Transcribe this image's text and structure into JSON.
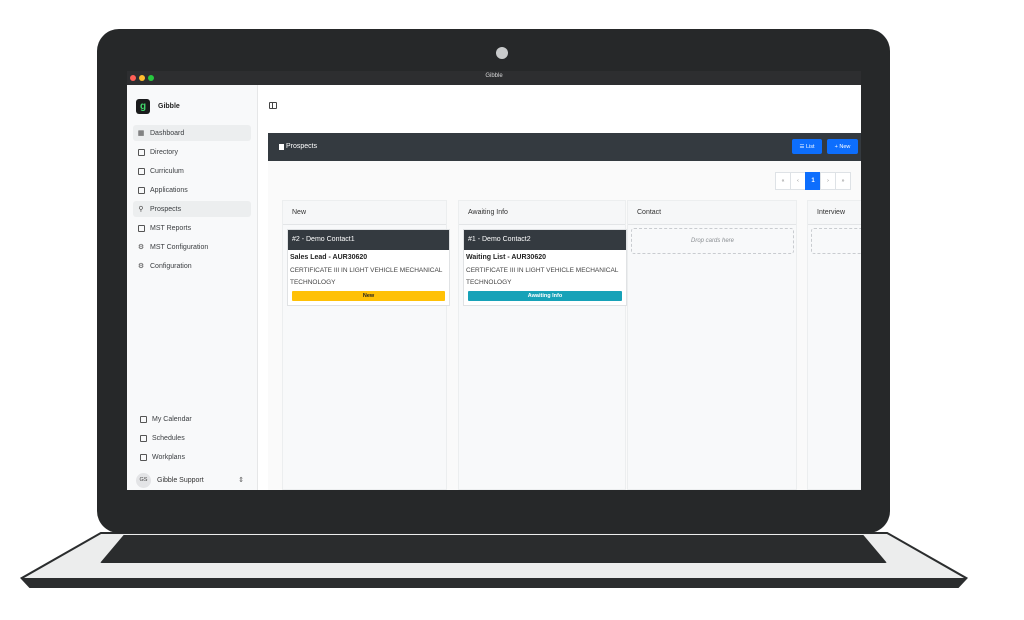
{
  "window": {
    "title": "Gibble"
  },
  "brand": {
    "logo": "g",
    "name": "Gibble"
  },
  "sidebar": {
    "items": [
      {
        "label": "Dashboard",
        "icon": "grid-icon"
      },
      {
        "label": "Directory",
        "icon": "book-icon"
      },
      {
        "label": "Curriculum",
        "icon": "monitor-icon"
      },
      {
        "label": "Applications",
        "icon": "file-icon"
      },
      {
        "label": "Prospects",
        "icon": "user-icon"
      },
      {
        "label": "MST Reports",
        "icon": "calendar-icon"
      },
      {
        "label": "MST Configuration",
        "icon": "gear-icon"
      },
      {
        "label": "Configuration",
        "icon": "gear-icon"
      }
    ],
    "bottom_items": [
      {
        "label": "My Calendar",
        "icon": "calendar-icon"
      },
      {
        "label": "Schedules",
        "icon": "calendar-icon"
      },
      {
        "label": "Workplans",
        "icon": "clipboard-icon"
      }
    ],
    "user": {
      "initials": "GS",
      "name": "Gibble Support"
    }
  },
  "main": {
    "header_title": "Prospects",
    "list_button": "☰ List",
    "new_button": "+ New",
    "pagination": {
      "first": "«",
      "prev": "‹",
      "current": "1",
      "next": "›",
      "last": "»"
    },
    "columns": [
      {
        "title": "New",
        "card": {
          "title": "#2 - Demo Contact1",
          "subtitle": "Sales Lead - AUR30620",
          "course": "CERTIFICATE III IN LIGHT VEHICLE MECHANICAL TECHNOLOGY",
          "badge": "New"
        }
      },
      {
        "title": "Awaiting Info",
        "card": {
          "title": "#1 - Demo Contact2",
          "subtitle": "Waiting List - AUR30620",
          "course": "CERTIFICATE III IN LIGHT VEHICLE MECHANICAL TECHNOLOGY",
          "badge": "Awaiting Info"
        }
      },
      {
        "title": "Contact",
        "placeholder": "Drop cards here"
      },
      {
        "title": "Interview"
      }
    ]
  },
  "colors": {
    "accent": "#0d6efd",
    "header": "#343a40",
    "badge_new": "#ffc107",
    "badge_awaiting": "#17a2b8"
  }
}
